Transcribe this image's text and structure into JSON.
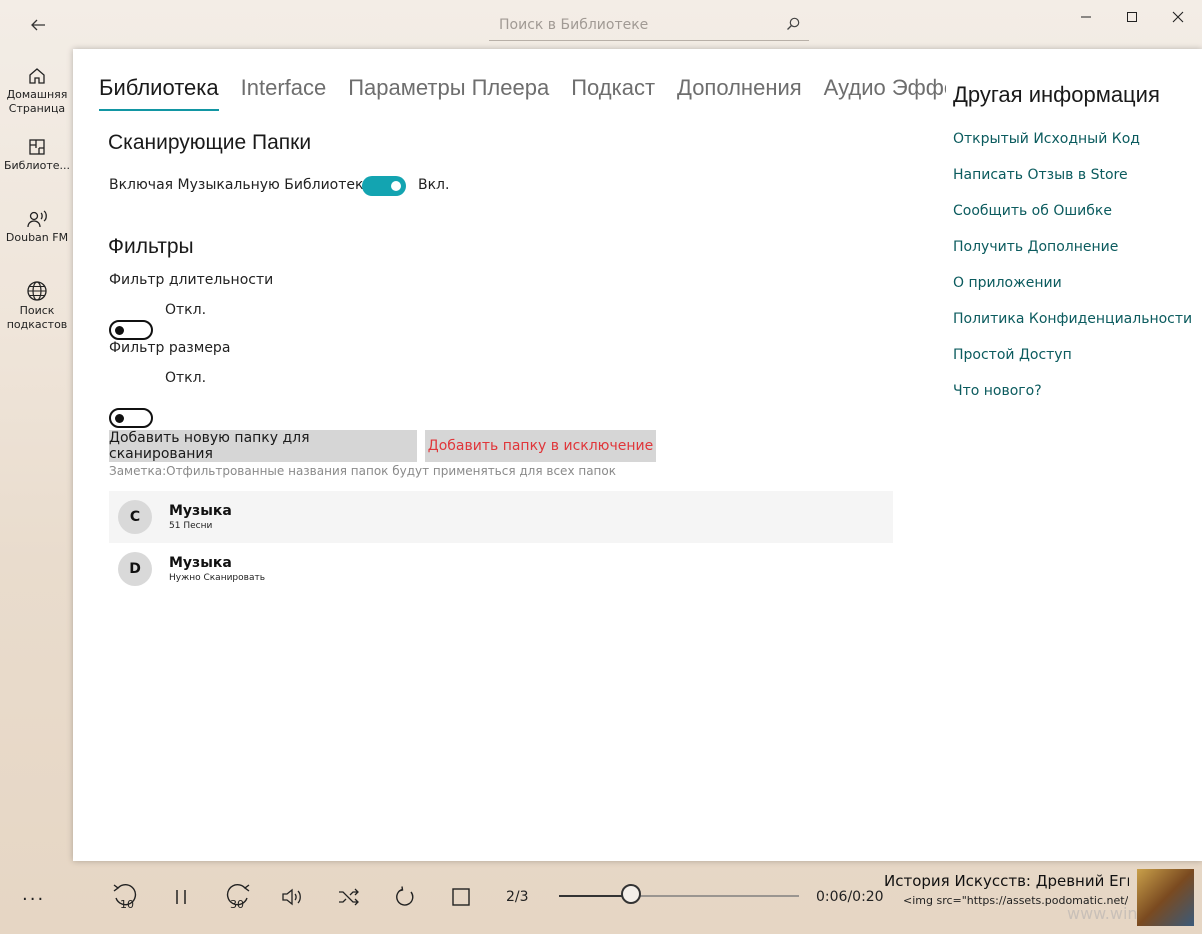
{
  "topbar": {
    "search_placeholder": "Поиск в Библиотеке"
  },
  "sidebar": {
    "items": [
      {
        "label": "Домашняя\nСтраница",
        "icon": "home-icon"
      },
      {
        "label": "Библиоте...",
        "icon": "library-icon"
      },
      {
        "label": "Douban FM",
        "icon": "radio-icon"
      },
      {
        "label": "Поиск\nподкастов",
        "icon": "globe-icon"
      }
    ],
    "more": "..."
  },
  "tabs": [
    "Библиотека",
    "Interface",
    "Параметры Плеера",
    "Подкаст",
    "Дополнения",
    "Аудио Эффекты"
  ],
  "library": {
    "scan_title": "Сканирующие Папки",
    "include_label": "Включая Музыкальную Библиотеку",
    "include_state": "Вкл.",
    "filters_title": "Фильтры",
    "duration_label": "Фильтр длительности",
    "duration_state": "Откл.",
    "size_label": "Фильтр размера",
    "size_state": "Откл.",
    "add_folder_btn": "Добавить новую папку для сканирования",
    "add_exclusion_btn": "Добавить папку в исключение",
    "note": "Заметка:Отфильтрованные названия папок будут применяться для всех папок",
    "folders": [
      {
        "drive": "C",
        "name": "Музыка",
        "sub": "51 Песни"
      },
      {
        "drive": "D",
        "name": "Музыка",
        "sub": "Нужно Сканировать"
      }
    ]
  },
  "other_info": {
    "title": "Другая информация",
    "links": [
      "Открытый Исходный Код",
      "Написать Отзыв в Store",
      "Сообщить об Ошибке",
      "Получить Дополнение",
      "О приложении",
      "Политика Конфиденциальности",
      "Простой Доступ",
      "Что нового?"
    ]
  },
  "player": {
    "rewind_label": "10",
    "forward_label": "30",
    "queue_pos": "2/3",
    "progress_fraction": 0.3,
    "time": "0:06/0:20",
    "track_title": "История Искусств: Древний Египет",
    "track_sub": "<img src=\"https://assets.podomatic.net/ts/",
    "watermark": "www.win"
  },
  "colors": {
    "accent": "#13a4b1",
    "link": "#0b5b5e",
    "exclusion_text": "#e0363a"
  }
}
